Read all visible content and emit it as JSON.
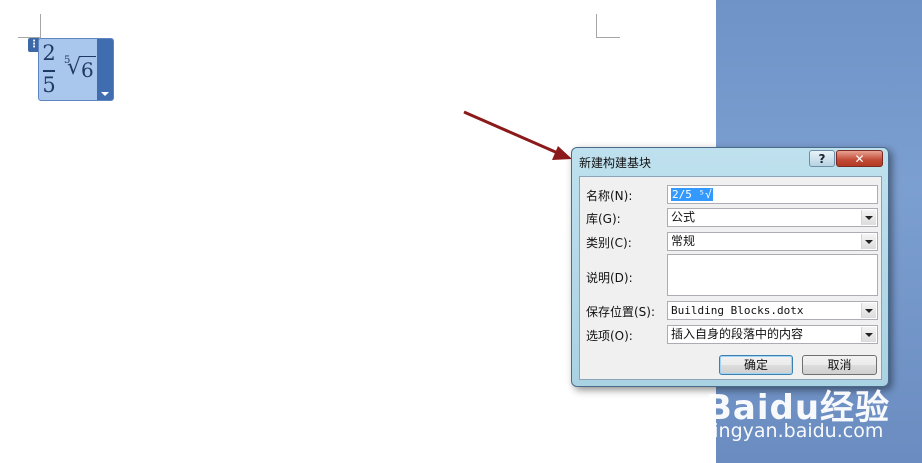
{
  "equation": {
    "numerator": "2",
    "denominator": "5",
    "root_index": "5",
    "radicand": "6"
  },
  "dialog": {
    "title": "新建构建基块",
    "help_label": "?",
    "close_label": "✕",
    "fields": {
      "name": {
        "label": "名称(N):",
        "value": "2/5 ⁵√"
      },
      "gallery": {
        "label": "库(G):",
        "value": "公式"
      },
      "category": {
        "label": "类别(C):",
        "value": "常规"
      },
      "description": {
        "label": "说明(D):",
        "value": ""
      },
      "save_in": {
        "label": "保存位置(S):",
        "value": "Building Blocks.dotx"
      },
      "options": {
        "label": "选项(O):",
        "value": "插入自身的段落中的内容"
      }
    },
    "ok_label": "确定",
    "cancel_label": "取消"
  },
  "watermark": {
    "brand": "Baidu经验",
    "url": "jingyan.baidu.com"
  },
  "colors": {
    "side_background": "#7c9fd1",
    "annotation_arrow": "#8b1a1a",
    "equation_fill": "#a9c6ec"
  }
}
